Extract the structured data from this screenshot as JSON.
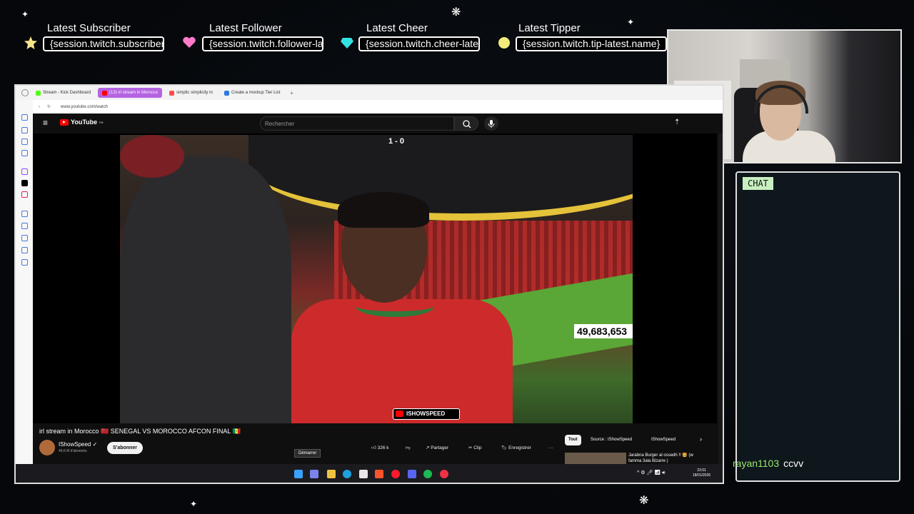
{
  "overlay": {
    "latest_subscriber_label": "Latest Subscriber",
    "latest_subscriber_value": "{session.twitch.subscriber-latest.name}",
    "latest_follower_label": "Latest Follower",
    "latest_follower_value": "{session.twitch.follower-latest.name}",
    "latest_cheer_label": "Latest Cheer",
    "latest_cheer_value": "{session.twitch.cheer-latest.name}",
    "latest_tipper_label": "Latest Tipper",
    "latest_tipper_value": "{session.twitch.tip-latest.name}",
    "star_colors": [
      "#f5e58a",
      "#ff7ac8",
      "#35e2e2",
      "#f3ec7c"
    ]
  },
  "chat": {
    "title": "CHAT",
    "message_user": "rayan1103",
    "message_text": "ccvv"
  },
  "browser": {
    "tabs": [
      {
        "label": "Stream - Kick Dashboard",
        "color": "#53fc18"
      },
      {
        "label": "(13) irl stream in Morocco",
        "color": "#ff0000",
        "active": true
      },
      {
        "label": "simplic simplicity m",
        "color": "#ff4d4d"
      },
      {
        "label": "Create a mockup Tier List",
        "color": "#2d7be0"
      }
    ],
    "url": "www.youtube.com/watch"
  },
  "youtube": {
    "logo_text": "YouTube",
    "logo_sup": "FR",
    "search_placeholder": "Rechercher",
    "video": {
      "score": "1 - 0",
      "counter_banner": "49,683,653",
      "watermark": "ISHOWSPEED"
    },
    "title": "irl stream in Morocco 🇲🇦 SENEGAL VS MOROCCO AFCON FINAL 🇸🇳",
    "channel_name": "IShowSpeed ✓",
    "channel_subs": "49,6 M d'abonnés",
    "subscribe_label": "S'abonner",
    "like_count": "326 k",
    "share_label": "Partager",
    "clip_label": "Clip",
    "save_label": "Enregistrer",
    "more_label": "···",
    "tooltip": "Démarrer",
    "chips": [
      "Tout",
      "Source : IShowSpeed",
      "IShowSpeed"
    ],
    "reco_title": "Jarabna Burger al ossedh !! 🍔 (w famma 3ala Bizarre )"
  },
  "taskbar": {
    "time": "23:01",
    "date": "18/01/2026"
  }
}
